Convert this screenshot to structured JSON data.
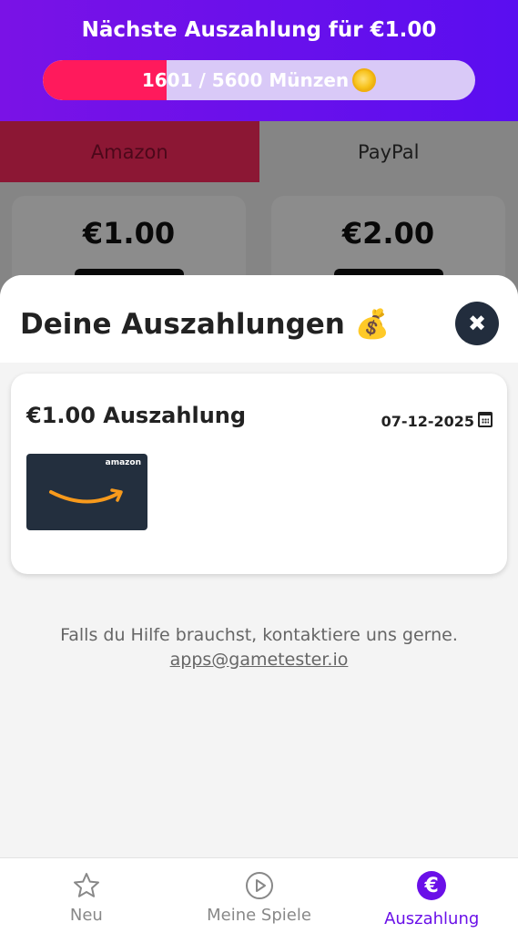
{
  "header": {
    "title": "Nächste Auszahlung für €1.00",
    "progress_text": "1601 / 5600 Münzen",
    "progress_current": 1601,
    "progress_total": 5600,
    "progress_fraction": 0.286
  },
  "tabs": [
    {
      "label": "Amazon"
    },
    {
      "label": "PayPal"
    }
  ],
  "background_cards": [
    {
      "amount": "€1.00"
    },
    {
      "amount": "€2.00"
    }
  ],
  "sheet": {
    "title": "Deine Auszahlungen 💰",
    "close_symbol": "✖"
  },
  "payout": {
    "title": "€1.00 Auszahlung",
    "date": "07-12-2025",
    "gift_card_brand": "amazon"
  },
  "help": {
    "text": "Falls du Hilfe brauchst, kontaktiere uns gerne.",
    "email": "apps@gametester.io"
  },
  "nav": [
    {
      "label": "Neu",
      "icon": "star-icon"
    },
    {
      "label": "Meine Spiele",
      "icon": "play-icon"
    },
    {
      "label": "Auszahlung",
      "icon": "euro-icon",
      "active": true
    }
  ],
  "colors": {
    "accent": "#6a10e8",
    "progress_fill": "#ff1a5c",
    "header_start": "#7a12e6",
    "header_end": "#5a0ef0"
  }
}
